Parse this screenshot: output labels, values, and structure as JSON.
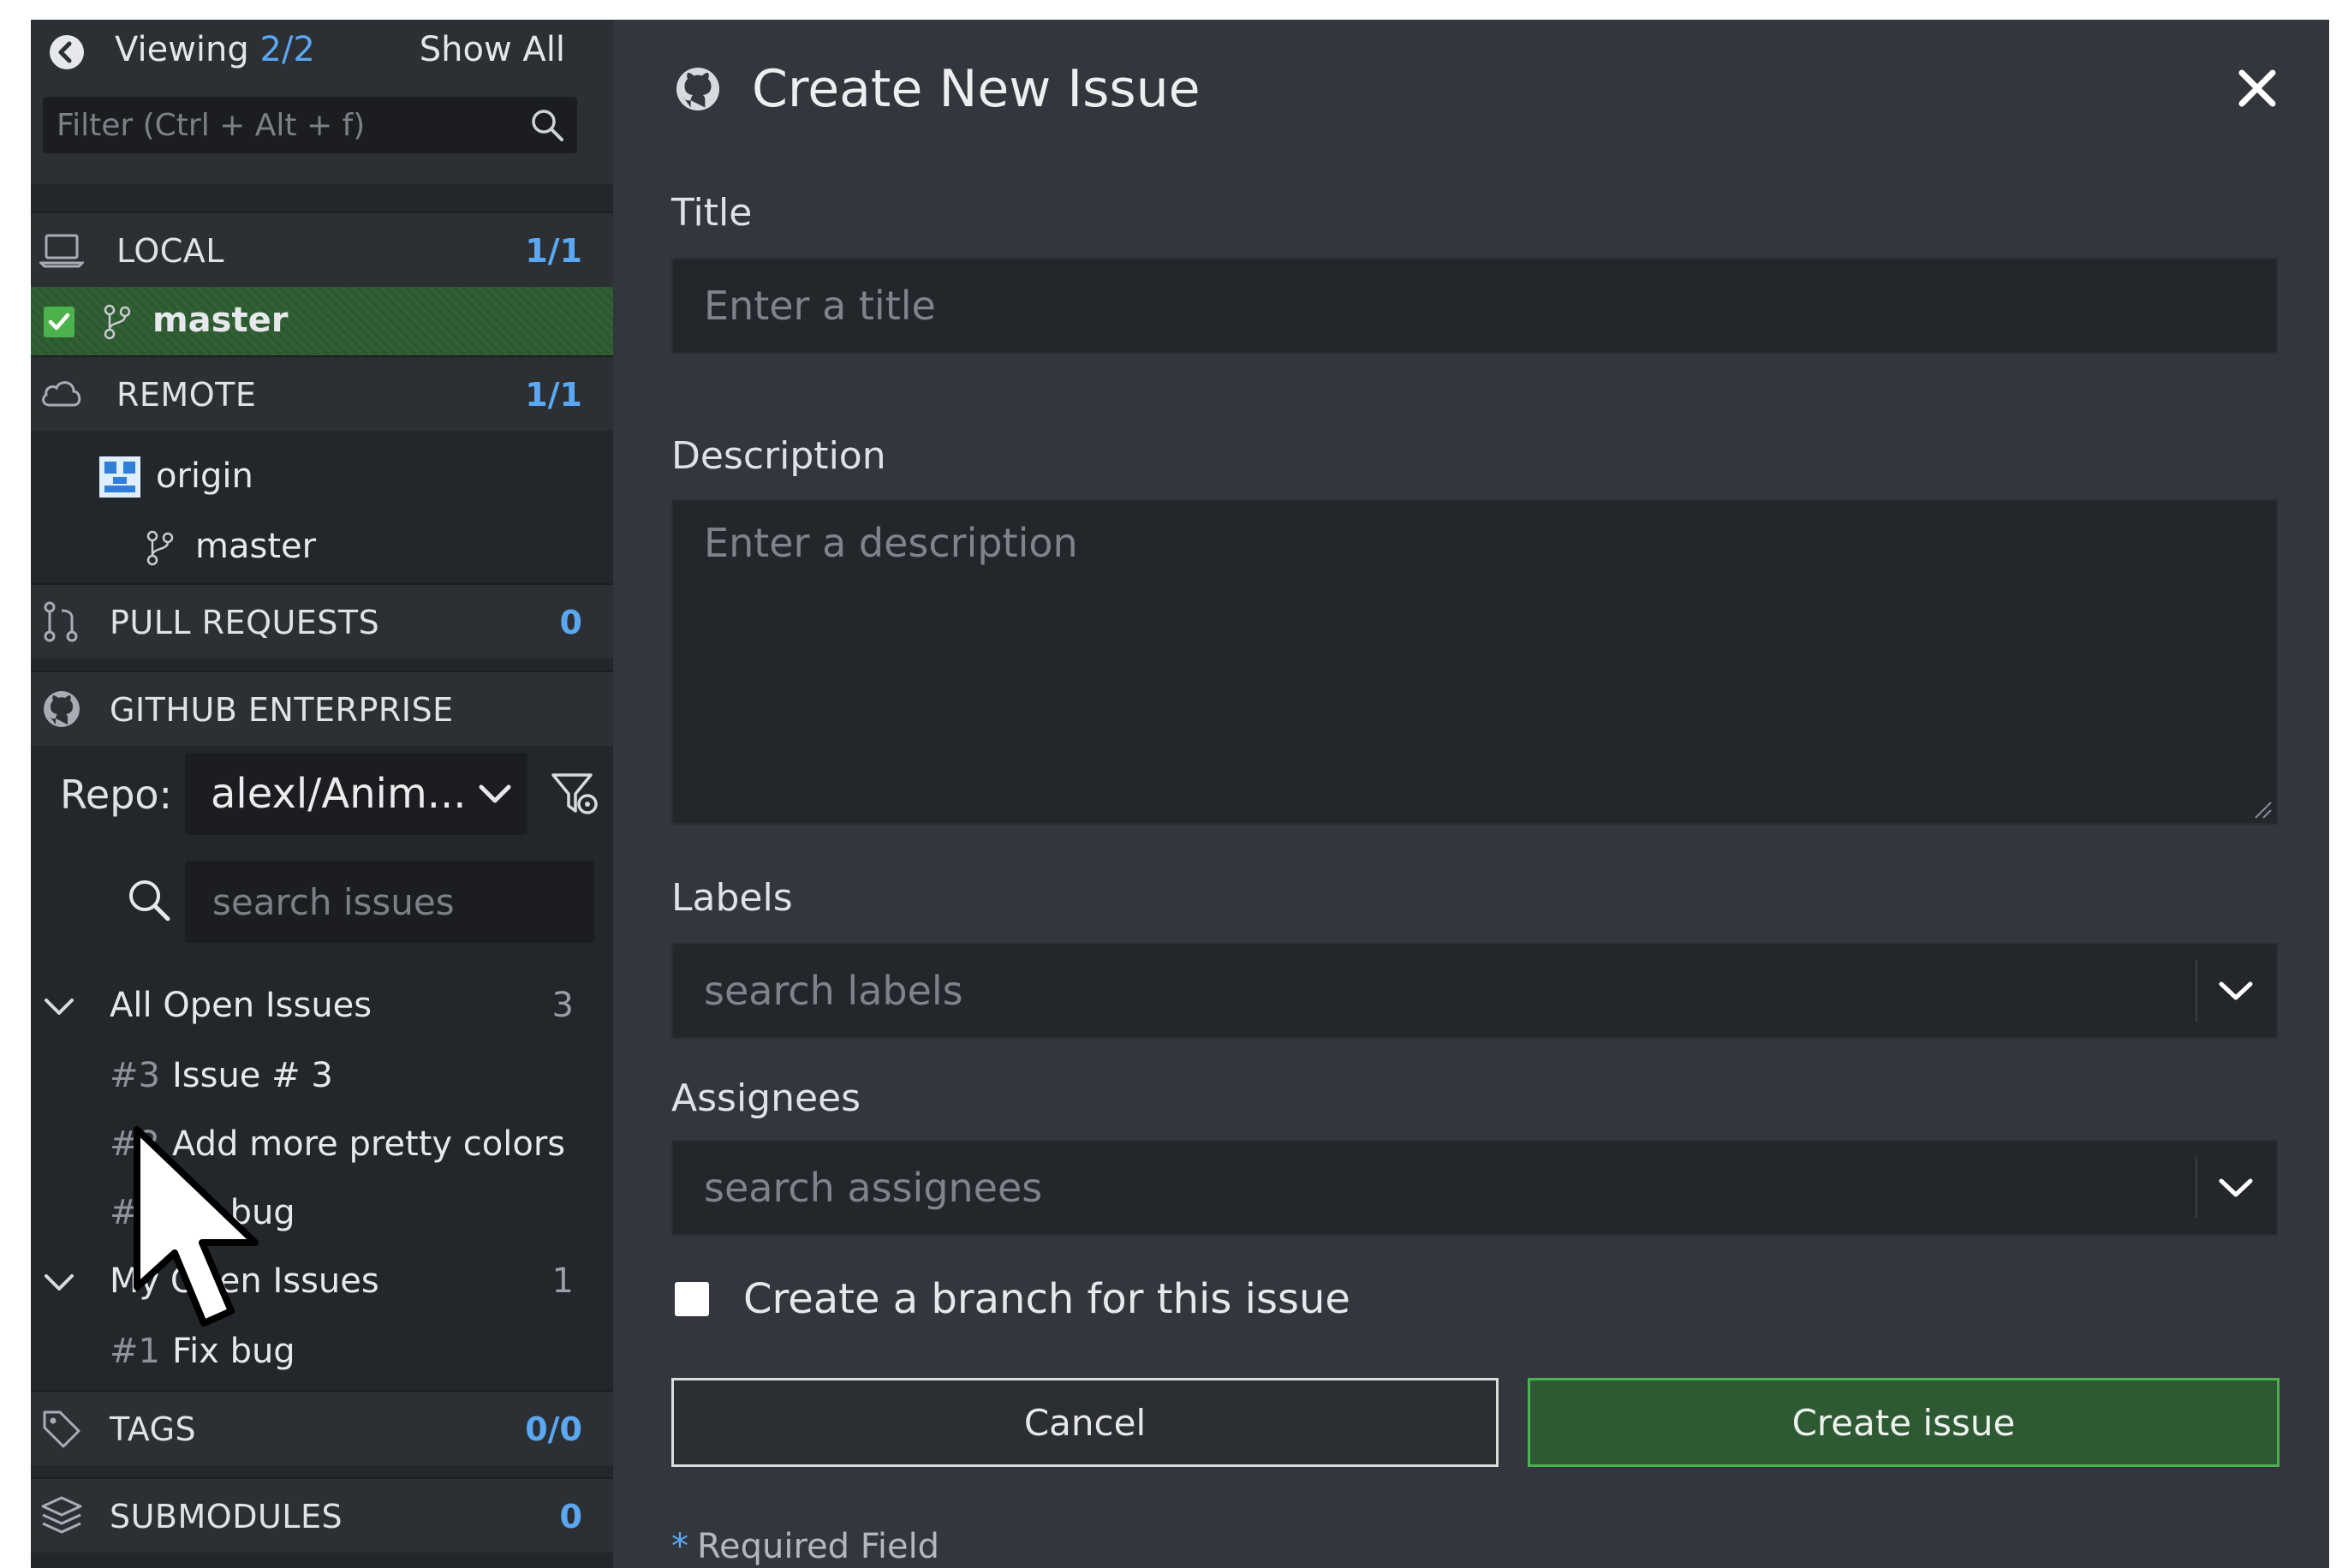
{
  "sidebar": {
    "viewing_label": "Viewing",
    "viewing_count": "2/2",
    "show_all": "Show All",
    "filter_placeholder": "Filter (Ctrl + Alt + f)",
    "local": {
      "label": "LOCAL",
      "count": "1/1",
      "branch": "master"
    },
    "remote": {
      "label": "REMOTE",
      "count": "1/1",
      "remote_name": "origin",
      "branch": "master"
    },
    "pull_requests": {
      "label": "PULL REQUESTS",
      "count": "0"
    },
    "github_enterprise": {
      "label": "GITHUB ENTERPRISE",
      "repo_label": "Repo:",
      "repo_value": "alexl/Anim...",
      "search_placeholder": "search issues",
      "groups": [
        {
          "label": "All Open Issues",
          "count": "3",
          "issues": [
            {
              "num": "#3",
              "title": "Issue # 3"
            },
            {
              "num": "#2",
              "title": "Add more pretty colors"
            },
            {
              "num": "#1",
              "title": "Fix bug"
            }
          ]
        },
        {
          "label": "My Open Issues",
          "count": "1",
          "issues": [
            {
              "num": "#1",
              "title": "Fix bug"
            }
          ]
        }
      ]
    },
    "tags": {
      "label": "TAGS",
      "count": "0/0"
    },
    "submodules": {
      "label": "SUBMODULES",
      "count": "0"
    }
  },
  "modal": {
    "title": "Create New Issue",
    "title_label": "Title",
    "title_placeholder": "Enter a title",
    "description_label": "Description",
    "description_placeholder": "Enter a description",
    "labels_label": "Labels",
    "labels_placeholder": "search labels",
    "assignees_label": "Assignees",
    "assignees_placeholder": "search assignees",
    "branch_checkbox": "Create a branch for this issue",
    "cancel": "Cancel",
    "create": "Create issue",
    "required_asterisk": "*",
    "required": "Required Field"
  },
  "colors": {
    "accent_blue": "#5aa7f2",
    "active_green": "#2c5a2f",
    "create_border": "#4cb24c"
  }
}
